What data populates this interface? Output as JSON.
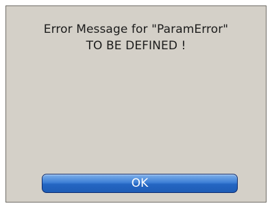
{
  "dialog": {
    "message_line1": "Error Message for \"ParamError\"",
    "message_line2": "TO BE DEFINED !",
    "ok_label": "OK"
  },
  "colors": {
    "dialog_background": "#d4d0c8",
    "button_blue": "#2466c2",
    "text": "#1b1b1b"
  }
}
